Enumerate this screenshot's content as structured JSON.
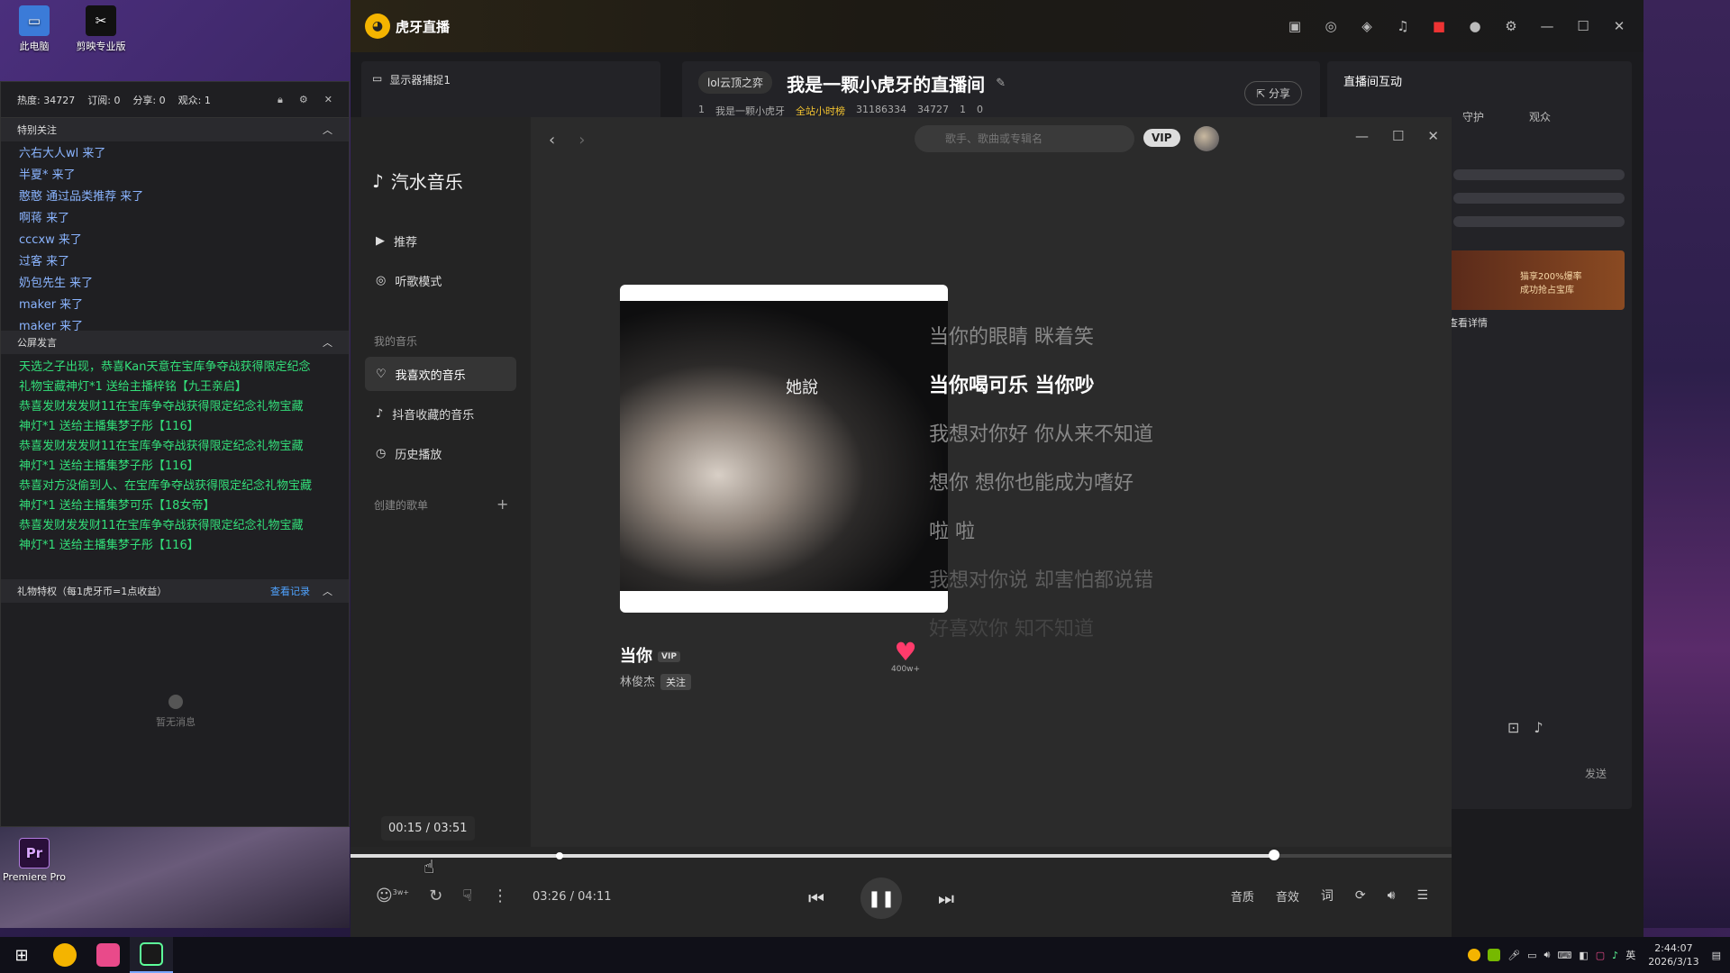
{
  "desktop": {
    "icons": [
      {
        "label": "此电脑"
      },
      {
        "label": "剪映专业版"
      },
      {
        "label": "Premiere Pro",
        "glyph": "Pr"
      }
    ]
  },
  "huya": {
    "app_name": "虎牙直播",
    "display_capture": "显示器捕捉1",
    "room_tag": "lol云顶之弈",
    "room_title": "我是一颗小虎牙的直播间",
    "share_label": "分享",
    "meta": {
      "level": "1",
      "streamer": "我是一颗小虎牙",
      "rank": "全站小时榜",
      "room_id": "31186334",
      "heat": "34727",
      "viewers": "1",
      "shares": "0"
    },
    "right_panel": {
      "title": "直播间互动",
      "tabs": [
        "守护",
        "观众"
      ],
      "banner_line1": "猫享200%爆率",
      "banner_line2": "成功抢占宝库",
      "detail": "查看详情",
      "send": "发送"
    }
  },
  "obs": {
    "stats": {
      "heat_label": "热度:",
      "heat": "34727",
      "sub_label": "订阅:",
      "sub": "0",
      "share_label": "分享:",
      "share": "0",
      "viewer_label": "观众:",
      "viewer": "1"
    },
    "special_follow": {
      "title": "特别关注",
      "items": [
        "六右大人wl 来了",
        "半夏* 来了",
        "憨憨 通过品类推荐 来了",
        "啊蒋 来了",
        "cccxw 来了",
        "过客 来了",
        "奶包先生 来了",
        "maker 来了",
        "maker 来了"
      ]
    },
    "announce": {
      "title": "公屏发言",
      "items": [
        "天选之子出现，恭喜Kan天意在宝库争夺战获得限定纪念",
        "礼物宝藏神灯*1 送给主播梓铭【九王亲启】",
        "恭喜发财发发财11在宝库争夺战获得限定纪念礼物宝藏",
        "神灯*1 送给主播集梦子彤【116】",
        "恭喜发财发发财11在宝库争夺战获得限定纪念礼物宝藏",
        "神灯*1 送给主播集梦子彤【116】",
        "恭喜对方没偷到人、在宝库争夺战获得限定纪念礼物宝藏",
        "神灯*1 送给主播集梦可乐【18女帝】",
        "恭喜发财发发财11在宝库争夺战获得限定纪念礼物宝藏",
        "神灯*1 送给主播集梦子彤【116】"
      ]
    },
    "gift": {
      "title": "礼物特权（每1虎牙币=1点收益）",
      "link": "查看记录"
    },
    "empty": "暂无消息"
  },
  "music": {
    "app_name": "汽水音乐",
    "nav": {
      "recommend": "推荐",
      "listen_mode": "听歌模式"
    },
    "my_music_label": "我的音乐",
    "my_music": [
      "我喜欢的音乐",
      "抖音收藏的音乐",
      "历史播放"
    ],
    "created_playlists": "创建的歌单",
    "search_placeholder": "歌手、歌曲或专辑名",
    "vip": "VIP",
    "cover_text": "她說",
    "song": {
      "title": "当你",
      "vip": "VIP",
      "artist": "林俊杰",
      "follow": "关注",
      "likes": "400w+"
    },
    "lyrics": [
      "当你的眼睛 眯着笑",
      "当你喝可乐 当你吵",
      "我想对你好 你从来不知道",
      "想你 想你也能成为嗜好",
      "啦 啦",
      "我想对你说 却害怕都说错",
      "好喜欢你 知不知道"
    ],
    "time_tip": "00:15 / 03:51",
    "player": {
      "time": "03:26 / 04:11",
      "progress": 0.839,
      "comment_count": "3w+",
      "quality": "音质",
      "effect": "音效"
    }
  },
  "taskbar": {
    "ime": "英",
    "time": "2:44:07",
    "date": "2026/3/13"
  }
}
